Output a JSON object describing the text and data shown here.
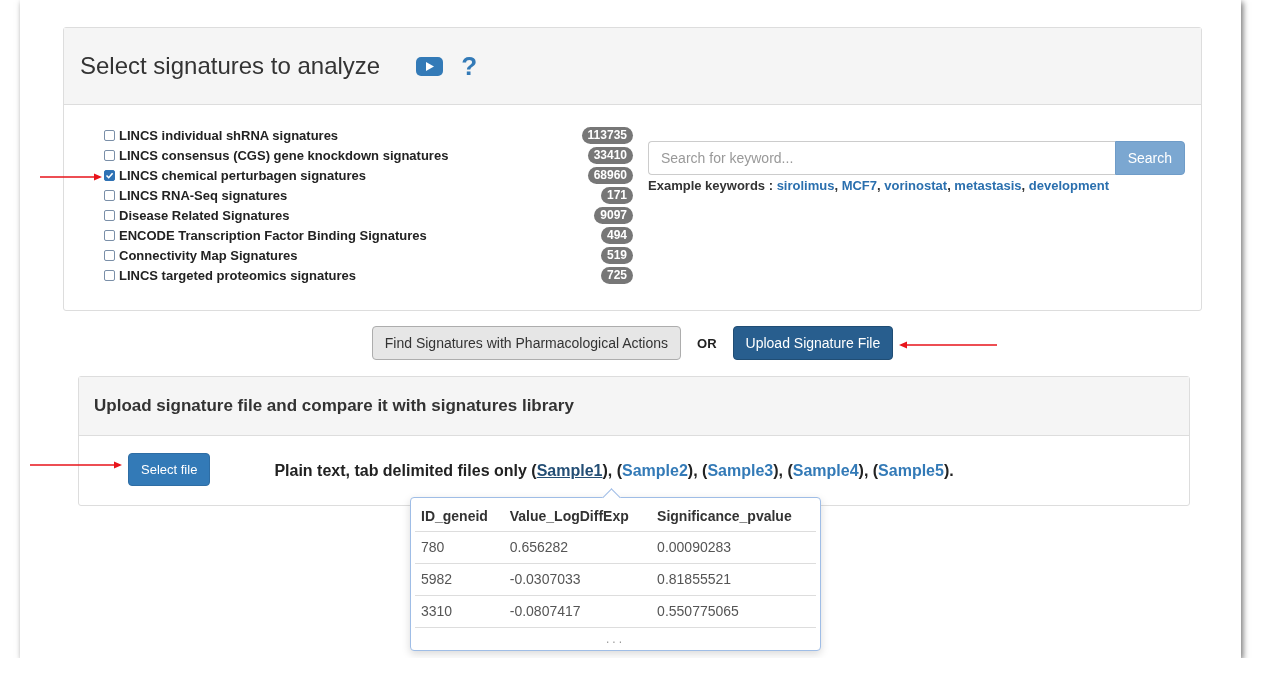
{
  "selection_panel": {
    "title": "Select signatures to analyze",
    "help_glyph": "?"
  },
  "signature_types": [
    {
      "label": "LINCS individual shRNA signatures",
      "count": "113735",
      "checked": false
    },
    {
      "label": "LINCS consensus (CGS) gene knockdown signatures",
      "count": "33410",
      "checked": false
    },
    {
      "label": "LINCS chemical perturbagen signatures",
      "count": "68960",
      "checked": true
    },
    {
      "label": "LINCS RNA-Seq signatures",
      "count": "171",
      "checked": false
    },
    {
      "label": "Disease Related Signatures",
      "count": "9097",
      "checked": false
    },
    {
      "label": "ENCODE Transcription Factor Binding Signatures",
      "count": "494",
      "checked": false
    },
    {
      "label": "Connectivity Map Signatures",
      "count": "519",
      "checked": false
    },
    {
      "label": "LINCS targeted proteomics signatures",
      "count": "725",
      "checked": false
    }
  ],
  "search": {
    "placeholder": "Search for keyword...",
    "button": "Search"
  },
  "example_keywords": {
    "label": "Example keywords :",
    "keywords": [
      {
        "text": "sirolimus",
        "after": ","
      },
      {
        "text": "MCF7",
        "after": ","
      },
      {
        "text": "vorinostat",
        "after": ","
      },
      {
        "text": "metastasis",
        "after": ","
      },
      {
        "text": "development"
      }
    ]
  },
  "actions": [
    {
      "kind": "button",
      "label": "Find Signatures with Pharmacological Actions",
      "selected": false
    },
    {
      "kind": "separator",
      "label": "OR"
    },
    {
      "kind": "button",
      "label": "Upload Signature File",
      "selected": true
    }
  ],
  "upload_panel": {
    "title": "Upload signature file and compare it with signatures library",
    "select_button": "Select file",
    "note": "Plain text, tab delimited files only ",
    "samples": [
      {
        "before": "(",
        "label": "Sample1",
        "after": "), ",
        "selected": true
      },
      {
        "before": "(",
        "label": "Sample2",
        "after": "), ",
        "selected": false
      },
      {
        "before": "(",
        "label": "Sample3",
        "after": "), ",
        "selected": false
      },
      {
        "before": "(",
        "label": "Sample4",
        "after": "), ",
        "selected": false
      },
      {
        "before": "(",
        "label": "Sample5",
        "after": ").",
        "selected": false
      }
    ],
    "preview": {
      "columns": [
        "ID_geneid",
        "Value_LogDiffExp",
        "Significance_pvalue"
      ],
      "rows": [
        [
          "780",
          "0.656282",
          "0.00090283"
        ],
        [
          "5982",
          "-0.0307033",
          "0.81855521"
        ],
        [
          "3310",
          "-0.0807417",
          "0.550775065"
        ]
      ],
      "more": "..."
    }
  }
}
